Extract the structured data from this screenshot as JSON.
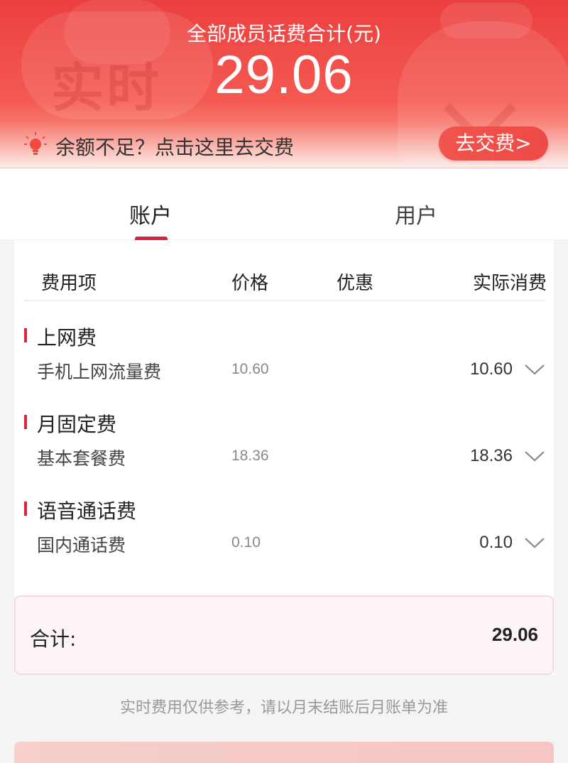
{
  "header": {
    "title": "全部成员话费合计(元)",
    "total": "29.06",
    "watermark": "实时"
  },
  "notice": {
    "icon": "lightbulb-icon",
    "text": "余额不足？点击这里去交费",
    "button_label": "去交费>"
  },
  "tabs": [
    {
      "label": "账户",
      "active": true
    },
    {
      "label": "用户",
      "active": false
    }
  ],
  "table": {
    "columns": [
      "费用项",
      "价格",
      "优惠",
      "实际消费"
    ],
    "groups": [
      {
        "category": "上网费",
        "items": [
          {
            "name": "手机上网流量费",
            "price": "10.60",
            "discount": "",
            "actual": "10.60"
          }
        ]
      },
      {
        "category": "月固定费",
        "items": [
          {
            "name": "基本套餐费",
            "price": "18.36",
            "discount": "",
            "actual": "18.36"
          }
        ]
      },
      {
        "category": "语音通话费",
        "items": [
          {
            "name": "国内通话费",
            "price": "0.10",
            "discount": "",
            "actual": "0.10"
          }
        ]
      }
    ]
  },
  "summary": {
    "label": "合计:",
    "value": "29.06"
  },
  "footnote": "实时费用仅供参考，请以月末结账后月账单为准",
  "colors": {
    "brand_red": "#ec3f3f",
    "accent_red": "#d9253a",
    "button_red": "#f1554d"
  }
}
